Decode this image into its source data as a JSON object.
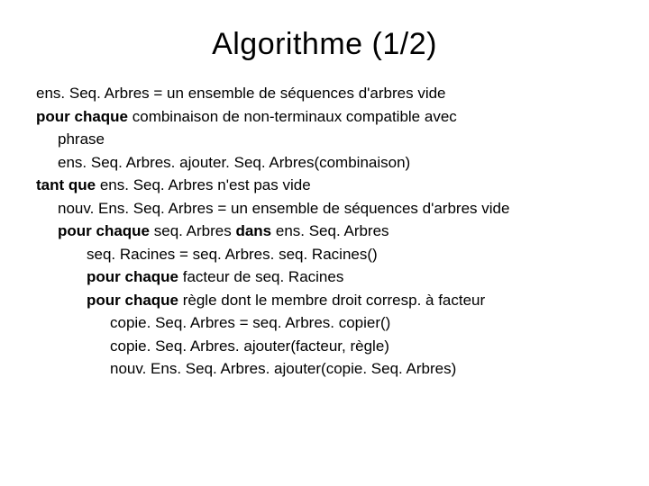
{
  "title": "Algorithme (1/2)",
  "lines": [
    {
      "indent": 0,
      "runs": [
        {
          "text": "ens. Seq. Arbres = un ensemble de séquences d'arbres vide",
          "bold": false
        }
      ]
    },
    {
      "indent": 0,
      "runs": [
        {
          "text": "pour chaque",
          "bold": true
        },
        {
          "text": " combinaison de non-terminaux compatible avec",
          "bold": false
        }
      ]
    },
    {
      "indent": 1,
      "runs": [
        {
          "text": "phrase",
          "bold": false
        }
      ]
    },
    {
      "indent": 1,
      "runs": [
        {
          "text": "ens. Seq. Arbres. ajouter. Seq. Arbres(combinaison)",
          "bold": false
        }
      ]
    },
    {
      "indent": 0,
      "runs": [
        {
          "text": "tant que",
          "bold": true
        },
        {
          "text": " ens. Seq. Arbres n'est pas vide",
          "bold": false
        }
      ]
    },
    {
      "indent": 1,
      "runs": [
        {
          "text": "nouv. Ens. Seq. Arbres = un ensemble de séquences d'arbres vide",
          "bold": false
        }
      ]
    },
    {
      "indent": 1,
      "runs": [
        {
          "text": "pour chaque",
          "bold": true
        },
        {
          "text": " seq. Arbres ",
          "bold": false
        },
        {
          "text": "dans",
          "bold": true
        },
        {
          "text": " ens. Seq. Arbres",
          "bold": false
        }
      ]
    },
    {
      "indent": 2,
      "runs": [
        {
          "text": "seq. Racines = seq. Arbres. seq. Racines()",
          "bold": false
        }
      ]
    },
    {
      "indent": 2,
      "runs": [
        {
          "text": "pour chaque",
          "bold": true
        },
        {
          "text": " facteur de seq. Racines",
          "bold": false
        }
      ]
    },
    {
      "indent": 2,
      "runs": [
        {
          "text": "pour chaque",
          "bold": true
        },
        {
          "text": " règle dont le membre droit corresp. à facteur",
          "bold": false
        }
      ]
    },
    {
      "indent": 3,
      "runs": [
        {
          "text": "copie. Seq. Arbres = seq. Arbres. copier()",
          "bold": false
        }
      ]
    },
    {
      "indent": 3,
      "runs": [
        {
          "text": "copie. Seq. Arbres. ajouter(facteur, règle)",
          "bold": false
        }
      ]
    },
    {
      "indent": 3,
      "runs": [
        {
          "text": "nouv. Ens. Seq. Arbres. ajouter(copie. Seq. Arbres)",
          "bold": false
        }
      ]
    }
  ]
}
